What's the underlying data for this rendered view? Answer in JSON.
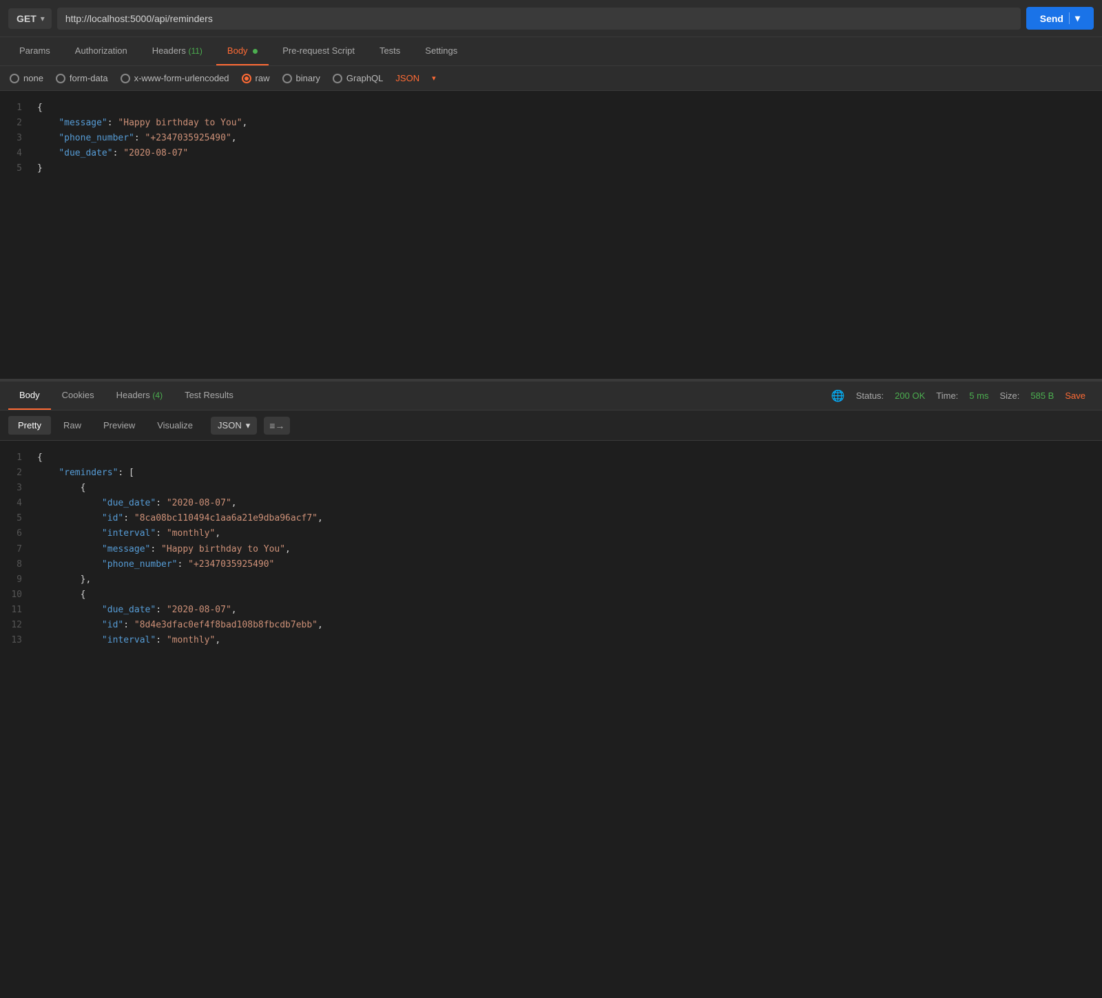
{
  "urlbar": {
    "method": "GET",
    "url": "http://localhost:5000/api/reminders",
    "send_label": "Send"
  },
  "req_tabs": [
    {
      "label": "Params",
      "active": false,
      "badge": null,
      "dot": false
    },
    {
      "label": "Authorization",
      "active": false,
      "badge": null,
      "dot": false
    },
    {
      "label": "Headers",
      "active": false,
      "badge": "11",
      "dot": false
    },
    {
      "label": "Body",
      "active": true,
      "badge": null,
      "dot": true
    },
    {
      "label": "Pre-request Script",
      "active": false,
      "badge": null,
      "dot": false
    },
    {
      "label": "Tests",
      "active": false,
      "badge": null,
      "dot": false
    },
    {
      "label": "Settings",
      "active": false,
      "badge": null,
      "dot": false
    }
  ],
  "body_types": [
    {
      "label": "none",
      "active": false
    },
    {
      "label": "form-data",
      "active": false
    },
    {
      "label": "x-www-form-urlencoded",
      "active": false
    },
    {
      "label": "raw",
      "active": true
    },
    {
      "label": "binary",
      "active": false
    },
    {
      "label": "GraphQL",
      "active": false
    }
  ],
  "json_type_label": "JSON",
  "request_body": [
    {
      "line": 1,
      "content": "{"
    },
    {
      "line": 2,
      "content": "    \"message\": \"Happy birthday to You\","
    },
    {
      "line": 3,
      "content": "    \"phone_number\": \"+2347035925490\","
    },
    {
      "line": 4,
      "content": "    \"due_date\": \"2020-08-07\""
    },
    {
      "line": 5,
      "content": "}"
    }
  ],
  "resp_tabs": [
    {
      "label": "Body",
      "active": true,
      "badge": null
    },
    {
      "label": "Cookies",
      "active": false,
      "badge": null
    },
    {
      "label": "Headers",
      "active": false,
      "badge": "4"
    },
    {
      "label": "Test Results",
      "active": false,
      "badge": null
    }
  ],
  "status": {
    "code": "200 OK",
    "time": "5 ms",
    "size": "585 B"
  },
  "resp_format_tabs": [
    {
      "label": "Pretty",
      "active": true
    },
    {
      "label": "Raw",
      "active": false
    },
    {
      "label": "Preview",
      "active": false
    },
    {
      "label": "Visualize",
      "active": false
    }
  ],
  "resp_format_type": "JSON",
  "save_label": "Save",
  "response_lines": [
    {
      "line": 1,
      "content": "{",
      "indent": 0
    },
    {
      "line": 2,
      "content": "    \"reminders\": [",
      "key": "reminders",
      "indent": 1
    },
    {
      "line": 3,
      "content": "        {",
      "indent": 2
    },
    {
      "line": 4,
      "content": "            \"due_date\": \"2020-08-07\",",
      "key": "due_date",
      "val": "2020-08-07",
      "indent": 3
    },
    {
      "line": 5,
      "content": "            \"id\": \"8ca08bc110494c1aa6a21e9dba96acf7\",",
      "key": "id",
      "val": "8ca08bc110494c1aa6a21e9dba96acf7",
      "indent": 3
    },
    {
      "line": 6,
      "content": "            \"interval\": \"monthly\",",
      "key": "interval",
      "val": "monthly",
      "indent": 3
    },
    {
      "line": 7,
      "content": "            \"message\": \"Happy birthday to You\",",
      "key": "message",
      "val": "Happy birthday to You",
      "indent": 3
    },
    {
      "line": 8,
      "content": "            \"phone_number\": \"+2347035925490\"",
      "key": "phone_number",
      "val": "+2347035925490",
      "indent": 3
    },
    {
      "line": 9,
      "content": "        },",
      "indent": 2
    },
    {
      "line": 10,
      "content": "        {",
      "indent": 2
    },
    {
      "line": 11,
      "content": "            \"due_date\": \"2020-08-07\",",
      "key": "due_date",
      "val": "2020-08-07",
      "indent": 3
    },
    {
      "line": 12,
      "content": "            \"id\": \"8d4e3dfac0ef4f8bad108b8fbcdb7ebb\",",
      "key": "id",
      "val": "8d4e3dfac0ef4f8bad108b8fbcdb7ebb",
      "indent": 3
    },
    {
      "line": 13,
      "content": "            \"interval\": \"monthly\",",
      "key": "interval",
      "val": "monthly",
      "indent": 3
    }
  ]
}
